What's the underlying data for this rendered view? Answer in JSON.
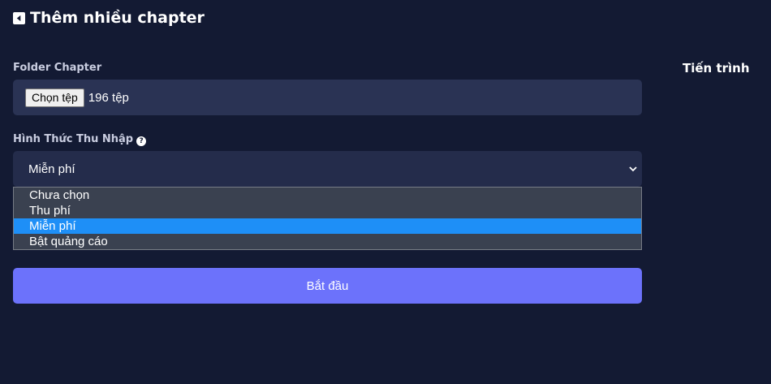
{
  "header": {
    "title": "Thêm nhiều chapter",
    "back_icon": "caret-left-square-icon"
  },
  "folder": {
    "label": "Folder Chapter",
    "choose_button": "Chọn tệp",
    "file_count": "196 tệp"
  },
  "income": {
    "label": "Hình Thức Thu Nhập",
    "help_icon": "question-circle-icon",
    "selected": "Miễn phí",
    "options": [
      "Chưa chọn",
      "Thu phí",
      "Miễn phí",
      "Bật quảng cáo"
    ]
  },
  "start_button": "Bắt đầu",
  "progress": {
    "title": "Tiến trình"
  },
  "colors": {
    "background": "#131a33",
    "field_bg": "#2a3354",
    "accent_button": "#6c72fb",
    "option_highlight": "#1e8ff7"
  }
}
